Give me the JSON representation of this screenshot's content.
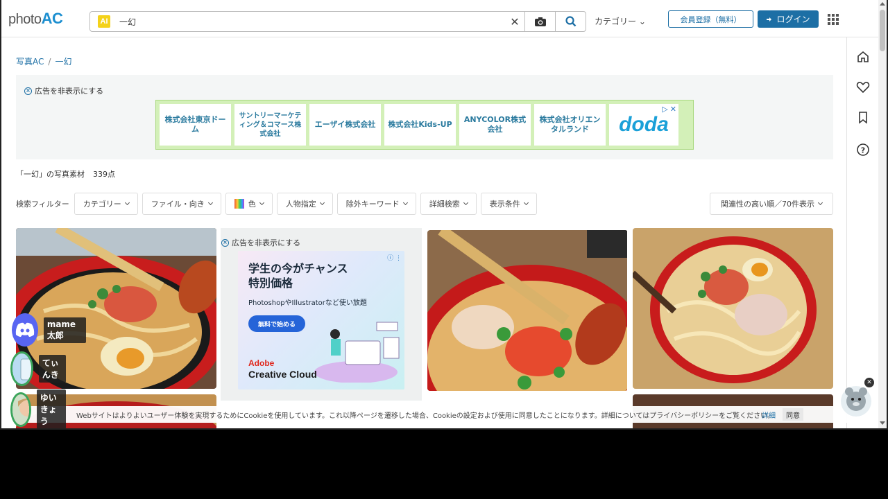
{
  "header": {
    "logo_prefix": "photo",
    "logo_suffix": "AC",
    "ai_badge": "AI",
    "search_value": "一幻",
    "category_dropdown": "カテゴリー",
    "register_label": "会員登録（無料）",
    "login_label": "ログイン"
  },
  "breadcrumb": {
    "home": "写真AC",
    "current": "一幻"
  },
  "ad_top": {
    "hide_label": "広告を非表示にする",
    "companies": [
      "株式会社東京ドーム",
      "サントリーマーケティング＆コマース株式会社",
      "エーザイ株式会社",
      "株式会社Kids-UP",
      "ANYCOLOR株式会社",
      "株式会社オリエンタルランド"
    ],
    "brand": "doda"
  },
  "results": {
    "label": "「一幻」の写真素材",
    "count": "339点"
  },
  "filters": {
    "label": "検索フィルター",
    "buttons": [
      "カテゴリー",
      "ファイル・向き",
      "色",
      "人物指定",
      "除外キーワード",
      "詳細検索",
      "表示条件"
    ],
    "sort": "関連性の高い順／70件表示"
  },
  "ad_tile": {
    "hide_label": "広告を非表示にする",
    "headline1": "学生の今がチャンス",
    "headline2": "特別価格",
    "sub": "PhotoshopやIllustratorなど使い放題",
    "cta": "無料で始める",
    "brand1": "Adobe",
    "brand2": "Creative Cloud"
  },
  "cookie": {
    "text": "Webサイトはよりよいユーザー体験を実現するためにCookieを使用しています。これ以降ページを遷移した場合、Cookieの設定および使用に同意したことになります。詳細についてはプライバシーポリシーをご覧ください。",
    "detail": "詳細",
    "agree": "同意"
  },
  "overlay_users": [
    "mame太郎",
    "てぃんき",
    "ゆいきょう"
  ],
  "colors": {
    "brand_blue": "#1d6fa5",
    "banner_green": "#d3f0b8",
    "discord": "#5865f2"
  }
}
